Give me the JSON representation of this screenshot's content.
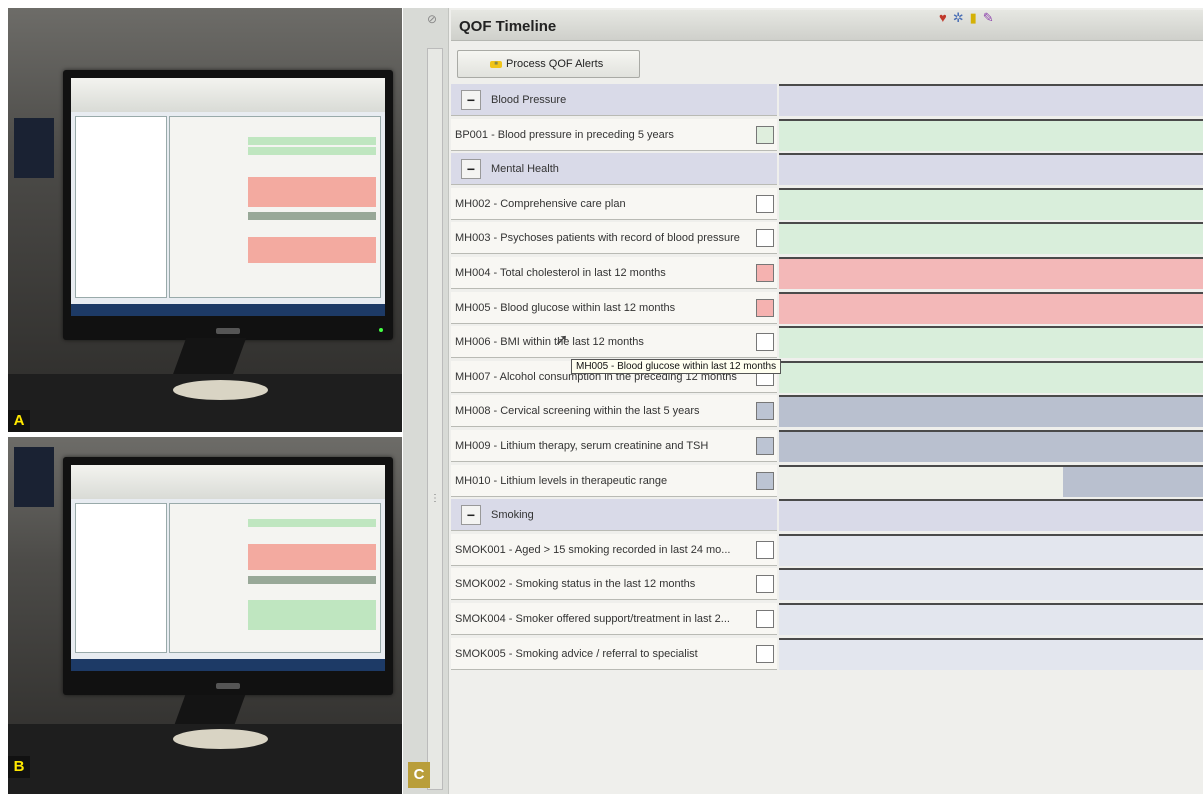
{
  "panel_labels": {
    "a": "A",
    "b": "B",
    "c": "C"
  },
  "qof": {
    "title": "QOF Timeline",
    "header_icons": [
      "heart-icon",
      "chart-icon",
      "clipboard-icon",
      "pen-icon"
    ],
    "process_button_label": "Process QOF Alerts",
    "groups": [
      {
        "id": "bp",
        "name": "Blood Pressure",
        "rows": [
          {
            "label": "BP001 - Blood pressure in preceding 5 years",
            "status": "green"
          }
        ]
      },
      {
        "id": "mh",
        "name": "Mental Health",
        "rows": [
          {
            "label": "MH002 - Comprehensive care plan",
            "status": "green"
          },
          {
            "label": "MH003 - Psychoses patients with record of blood pressure",
            "status": "green"
          },
          {
            "label": "MH004 - Total cholesterol in last 12 months",
            "status": "red"
          },
          {
            "label": "MH005 - Blood glucose within last 12 months",
            "status": "red"
          },
          {
            "label": "MH006 - BMI within the last 12 months",
            "status": "green"
          },
          {
            "label": "MH007 - Alcohol consumption in the preceding 12 months",
            "status": "green"
          },
          {
            "label": "MH008 - Cervical screening within the last 5 years",
            "status": "grey"
          },
          {
            "label": "MH009 - Lithium therapy, serum creatinine and TSH",
            "status": "grey"
          },
          {
            "label": "MH010 - Lithium levels in therapeutic range",
            "status": "grey-partial"
          }
        ]
      },
      {
        "id": "sm",
        "name": "Smoking",
        "rows": [
          {
            "label": "SMOK001 - Aged > 15 smoking recorded in last 24 mo...",
            "status": "none"
          },
          {
            "label": "SMOK002 - Smoking status in the last 12 months",
            "status": "none"
          },
          {
            "label": "SMOK004 - Smoker offered support/treatment in last 2...",
            "status": "none"
          },
          {
            "label": "SMOK005 - Smoking advice / referral to specialist",
            "status": "none"
          }
        ]
      }
    ],
    "tooltip": "MH005 - Blood glucose within last 12 months"
  }
}
